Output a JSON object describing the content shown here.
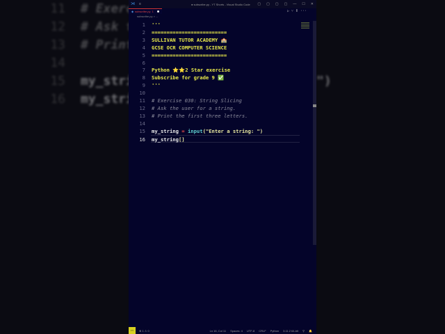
{
  "background_code": [
    {
      "n": "11",
      "t": "# Exercise"
    },
    {
      "n": "12",
      "t": "# Ask the"
    },
    {
      "n": "13",
      "t": "# Print th"
    },
    {
      "n": "14",
      "t": ""
    },
    {
      "n": "15",
      "t": "my_string"
    },
    {
      "n": "16",
      "t": "my_string["
    }
  ],
  "background_right": "\")",
  "titlebar": {
    "menu_icon": "hamburger-icon",
    "title": "● subscribe.py - YT Shorts - Visual Studio Code",
    "controls": [
      "▢",
      "▢",
      "▢",
      "▢",
      "—",
      "☐",
      "✕"
    ]
  },
  "tab": {
    "label": "subscribe.py",
    "modified": "1"
  },
  "tab_actions": [
    "▷ ˅",
    "⫴",
    "···"
  ],
  "breadcrumb": "subscribe.py > ...",
  "lines": [
    {
      "n": "1",
      "parts": [
        {
          "c": "y",
          "t": "'''"
        }
      ]
    },
    {
      "n": "2",
      "parts": [
        {
          "c": "y",
          "t": "========================="
        }
      ]
    },
    {
      "n": "3",
      "parts": [
        {
          "c": "y",
          "t": "SULLIVAN TUTOR ACADEMY 🏫"
        }
      ]
    },
    {
      "n": "4",
      "parts": [
        {
          "c": "y",
          "t": "GCSE OCR COMPUTER SCIENCE"
        }
      ]
    },
    {
      "n": "5",
      "parts": [
        {
          "c": "y",
          "t": "========================="
        }
      ]
    },
    {
      "n": "6",
      "parts": []
    },
    {
      "n": "7",
      "parts": [
        {
          "c": "y",
          "t": "Python ⭐⭐2 Star exercise"
        }
      ]
    },
    {
      "n": "8",
      "parts": [
        {
          "c": "y",
          "t": "Subscribe for grade 9 ✅"
        }
      ]
    },
    {
      "n": "9",
      "parts": [
        {
          "c": "y",
          "t": "'''"
        }
      ]
    },
    {
      "n": "10",
      "parts": []
    },
    {
      "n": "11",
      "parts": [
        {
          "c": "c",
          "t": "# Exercise 030: String Slicing"
        }
      ]
    },
    {
      "n": "12",
      "parts": [
        {
          "c": "c",
          "t": "# Ask the user for a string."
        }
      ]
    },
    {
      "n": "13",
      "parts": [
        {
          "c": "c",
          "t": "# Print the first three letters."
        }
      ]
    },
    {
      "n": "14",
      "parts": []
    },
    {
      "n": "15",
      "parts": [
        {
          "c": "w",
          "t": "my_string "
        },
        {
          "c": "o",
          "t": "="
        },
        {
          "c": "w",
          "t": " "
        },
        {
          "c": "f",
          "t": "input"
        },
        {
          "c": "s",
          "t": "(\"Enter a string: \")"
        }
      ]
    },
    {
      "n": "16",
      "parts": [
        {
          "c": "w",
          "t": "my_string"
        },
        {
          "c": "s",
          "t": "[]"
        }
      ]
    }
  ],
  "current_line": "16",
  "status": {
    "remote": "><",
    "problems": "⊗ 1 ⚠ 0",
    "items": [
      "Ln 16, Col 11",
      "Spaces: 4",
      "UTF-8",
      "CRLF",
      "Python",
      "3.11.2 64-bit",
      "⚲",
      "🔔"
    ]
  }
}
